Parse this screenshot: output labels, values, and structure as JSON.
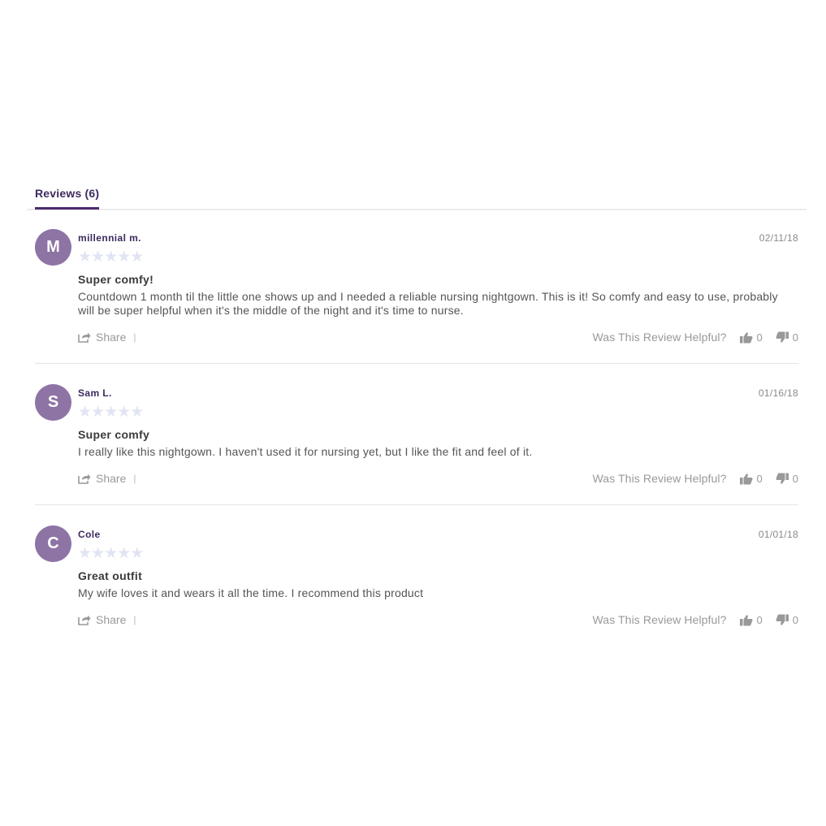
{
  "tabs": {
    "reviews_label": "Reviews (6)"
  },
  "labels": {
    "share": "Share",
    "helpful": "Was This Review Helpful?"
  },
  "reviews": [
    {
      "initial": "M",
      "author": "millennial m.",
      "date": "02/11/18",
      "rating": 0,
      "title": "Super comfy!",
      "body": "Countdown 1 month til the little one shows up and I needed a reliable nursing nightgown. This is it! So comfy and easy to use, probably will be super helpful when it's the middle of the night and it's time to nurse.",
      "helpful_yes": "0",
      "helpful_no": "0"
    },
    {
      "initial": "S",
      "author": "Sam L.",
      "date": "01/16/18",
      "rating": 0,
      "title": "Super comfy",
      "body": "I really like this nightgown. I haven't used it for nursing yet, but I like the fit and feel of it.",
      "helpful_yes": "0",
      "helpful_no": "0"
    },
    {
      "initial": "C",
      "author": "Cole",
      "date": "01/01/18",
      "rating": 0,
      "title": "Great outfit",
      "body": "My wife loves it and wears it all the time. I recommend this product",
      "helpful_yes": "0",
      "helpful_no": "0"
    }
  ],
  "colors": {
    "avatar": "#8e74a5",
    "accent": "#4b2a6e",
    "star_empty": "#e1e4f3"
  }
}
